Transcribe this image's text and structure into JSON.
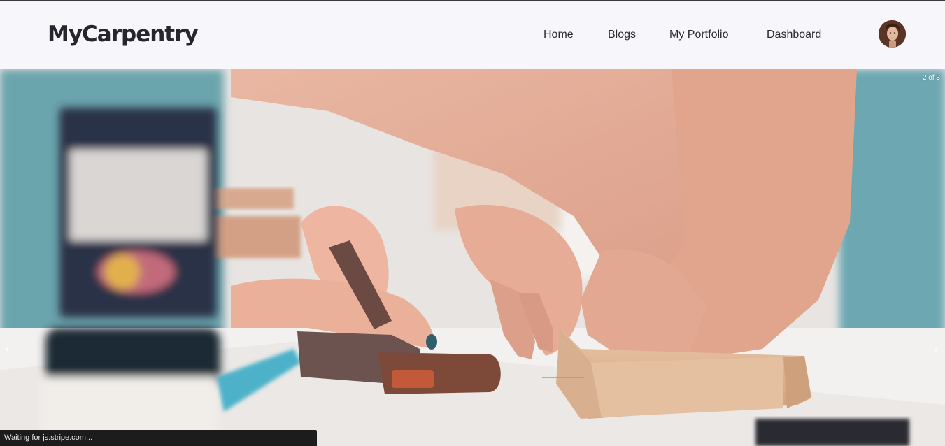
{
  "navbar": {
    "brand": "MyCarpentry",
    "links": [
      {
        "label": "Home"
      },
      {
        "label": "Blogs"
      },
      {
        "label": "My Portfolio"
      },
      {
        "label": "Dashboard"
      }
    ],
    "avatar_icon": "user-avatar"
  },
  "carousel": {
    "counter": "2 of 3",
    "prev_icon": "chevron-left-icon",
    "next_icon": "chevron-right-icon",
    "prev_glyph": "‹",
    "next_glyph": "›"
  },
  "status_bar": {
    "text": "Waiting for js.stripe.com..."
  }
}
